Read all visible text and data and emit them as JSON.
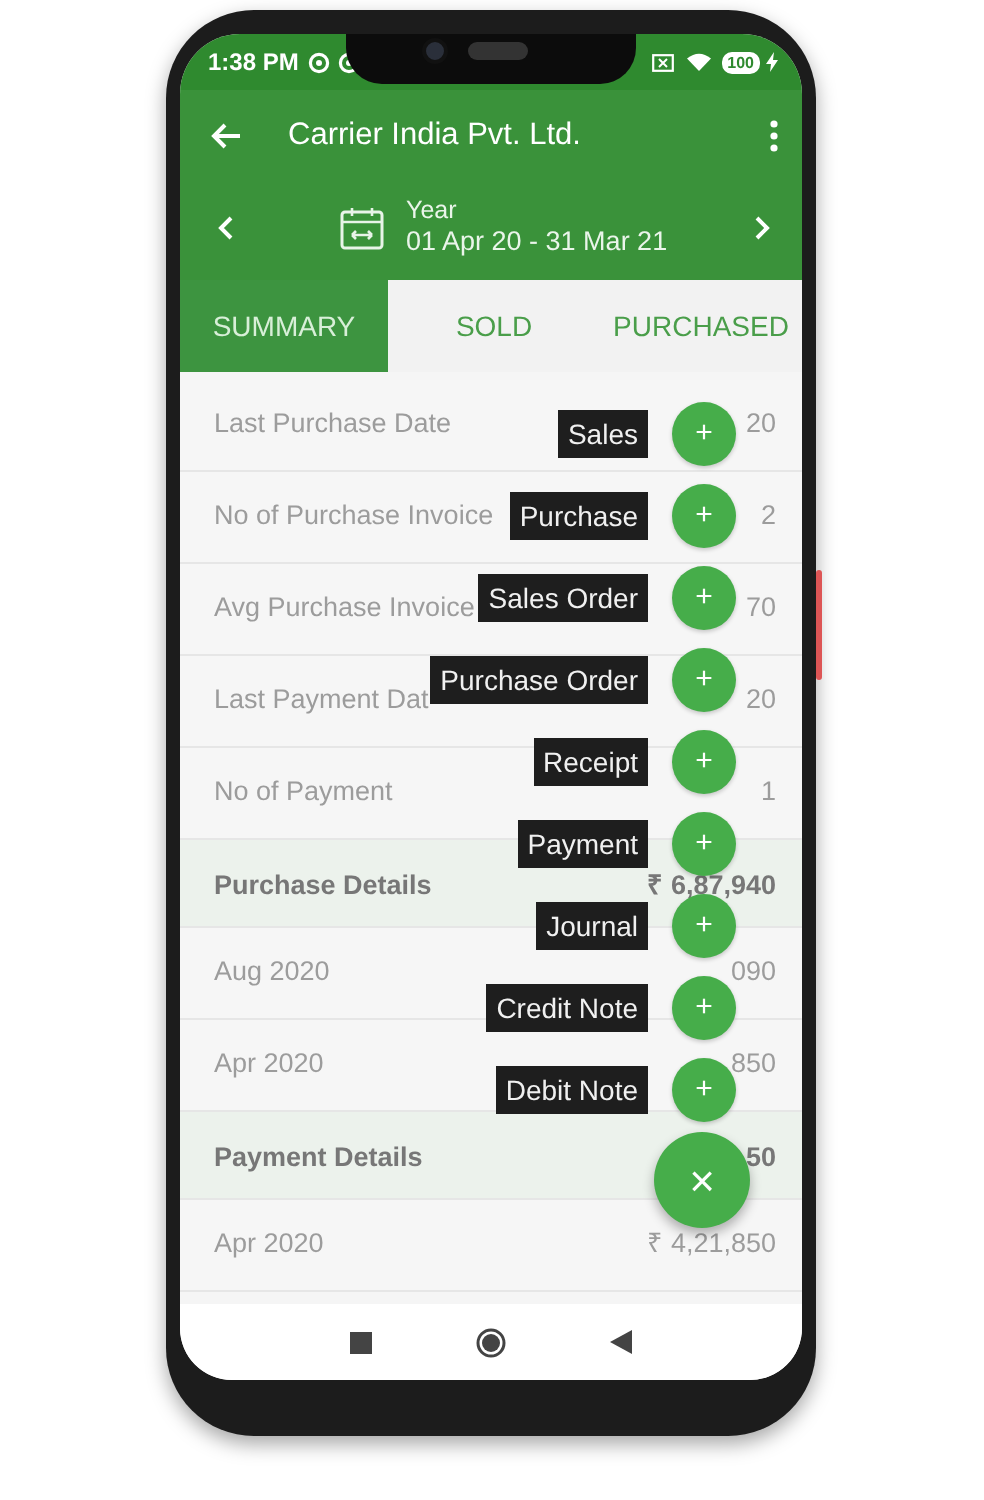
{
  "status_bar": {
    "time": "1:38 PM",
    "battery": "100"
  },
  "app_bar": {
    "title": "Carrier India Pvt. Ltd.",
    "period_label": "Year",
    "period_range": "01 Apr 20 - 31 Mar 21"
  },
  "tabs": [
    {
      "label": "SUMMARY",
      "selected": true
    },
    {
      "label": "SOLD",
      "selected": false
    },
    {
      "label": "PURCHASED",
      "selected": false
    }
  ],
  "rows": [
    {
      "kind": "item",
      "label": "Last Purchase Date",
      "value": "20"
    },
    {
      "kind": "item",
      "label": "No of Purchase Invoice",
      "value": "2"
    },
    {
      "kind": "item",
      "label": "Avg Purchase Invoice",
      "value": "70"
    },
    {
      "kind": "item",
      "label": "Last Payment Dat",
      "value": "20"
    },
    {
      "kind": "item",
      "label": "No of Payment",
      "value": "1"
    },
    {
      "kind": "section",
      "label": "Purchase Details",
      "value": "₹ 6,87,940"
    },
    {
      "kind": "item",
      "label": "Aug 2020",
      "value": "090"
    },
    {
      "kind": "item",
      "label": "Apr 2020",
      "value": "850"
    },
    {
      "kind": "section",
      "label": "Payment Details",
      "value": "50"
    },
    {
      "kind": "item",
      "label": "Apr 2020",
      "value": "₹ 4,21,850"
    }
  ],
  "fab_menu": {
    "actions": [
      {
        "label": "Sales",
        "icon": "+"
      },
      {
        "label": "Purchase",
        "icon": "+"
      },
      {
        "label": "Sales Order",
        "icon": "+"
      },
      {
        "label": "Purchase Order",
        "icon": "+"
      },
      {
        "label": "Receipt",
        "icon": "+"
      },
      {
        "label": "Payment",
        "icon": "+"
      },
      {
        "label": "Journal",
        "icon": "+"
      },
      {
        "label": "Credit Note",
        "icon": "+"
      },
      {
        "label": "Debit Note",
        "icon": "+"
      }
    ],
    "close": "×"
  }
}
